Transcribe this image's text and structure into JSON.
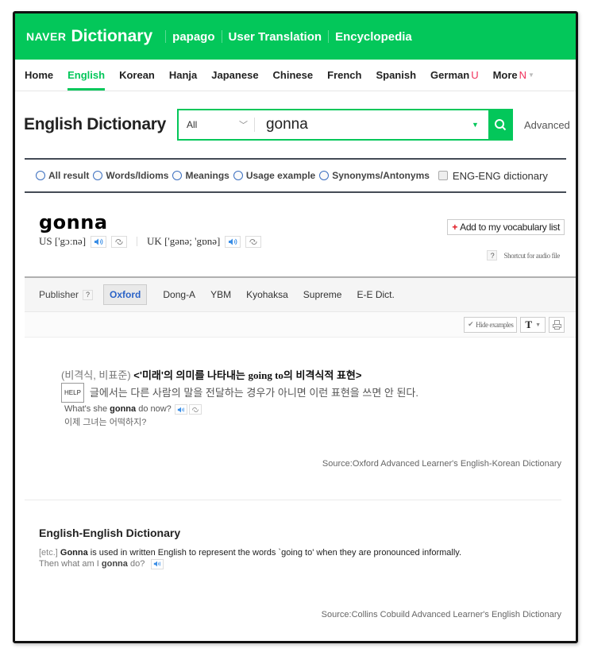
{
  "header": {
    "brand": "NAVER",
    "product": "Dictionary",
    "links": [
      "papago",
      "User Translation",
      "Encyclopedia"
    ]
  },
  "language_nav": {
    "items": [
      {
        "label": "Home",
        "active": false,
        "badge": ""
      },
      {
        "label": "English",
        "active": true,
        "badge": ""
      },
      {
        "label": "Korean",
        "active": false,
        "badge": ""
      },
      {
        "label": "Hanja",
        "active": false,
        "badge": ""
      },
      {
        "label": "Japanese",
        "active": false,
        "badge": ""
      },
      {
        "label": "Chinese",
        "active": false,
        "badge": ""
      },
      {
        "label": "French",
        "active": false,
        "badge": ""
      },
      {
        "label": "Spanish",
        "active": false,
        "badge": ""
      },
      {
        "label": "German",
        "active": false,
        "badge": "U"
      },
      {
        "label": "More",
        "active": false,
        "badge": "N"
      }
    ]
  },
  "search": {
    "section_title": "English Dictionary",
    "scope_selected": "All",
    "query": "gonna",
    "advanced_label": "Advanced"
  },
  "filters": {
    "radios": [
      "All result",
      "Words/Idioms",
      "Meanings",
      "Usage example",
      "Synonyms/Antonyms"
    ],
    "checkbox_label": "ENG-ENG dictionary",
    "checkbox_checked": false
  },
  "entry": {
    "word": "gonna",
    "us_label": "US",
    "us_ipa": "['gɔːnə]",
    "uk_label": "UK",
    "uk_ipa": "['gənə; 'gɒnə]",
    "add_vocab_label": "Add to my vocabulary list",
    "shortcut_help": "?",
    "shortcut_label": "Shortcut for audio file"
  },
  "publishers": {
    "label": "Publisher",
    "help": "?",
    "tabs": [
      {
        "label": "Oxford",
        "active": true
      },
      {
        "label": "Dong-A",
        "active": false
      },
      {
        "label": "YBM",
        "active": false
      },
      {
        "label": "Kyohaksa",
        "active": false
      },
      {
        "label": "Supreme",
        "active": false
      },
      {
        "label": "E-E Dict.",
        "active": false
      }
    ]
  },
  "toolbar": {
    "hide_examples_label": "Hide examples",
    "font_label": "T"
  },
  "oxford": {
    "category": "(비격식, 비표준)",
    "meaning_prefix": "<'미래'의 의미를 나타내는 ",
    "meaning_en": "going to",
    "meaning_suffix": "의 비격식적 표현>",
    "help_tag": "HELP",
    "help_text": "글에서는 다른 사람의 말을 전달하는 경우가 아니면 이런 표현을 쓰면 안 된다.",
    "example_before": "What's she ",
    "example_bold": "gonna",
    "example_after": " do now?",
    "example_translation": "이제 그녀는 어떡하지?",
    "source": "Source:Oxford Advanced Learner's English-Korean Dictionary"
  },
  "ee_dictionary": {
    "title": "English-English Dictionary",
    "tag": "[etc.]",
    "def_bold": "Gonna",
    "def_rest": " is used in written English to represent the words `going to' when they are pronounced informally.",
    "example_before": "Then what am I ",
    "example_bold": "gonna",
    "example_after": " do?",
    "source": "Source:Collins Cobuild Advanced Learner's English Dictionary"
  },
  "colors": {
    "brand_green": "#03c75a",
    "link_blue": "#2b63c7",
    "badge_red": "#f0305a"
  }
}
